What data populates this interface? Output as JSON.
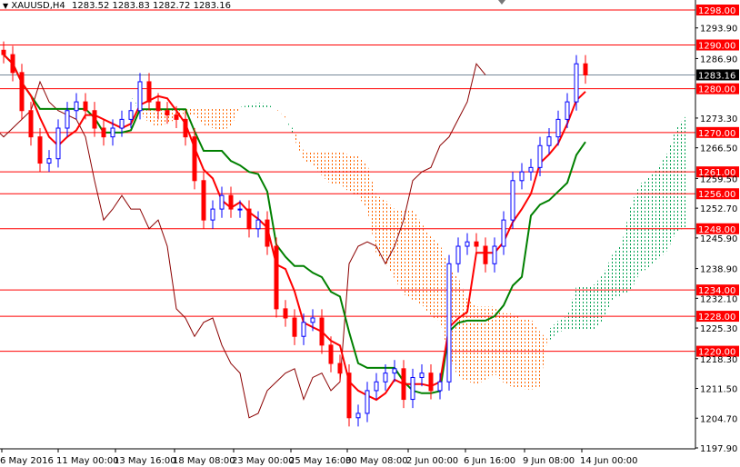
{
  "header": {
    "symbol": "XAUUSD,H4",
    "ohlc": "1283.52 1283.83 1282.72 1283.16"
  },
  "colors": {
    "level": "#ff0000",
    "tenkan": "#ff0000",
    "kijun": "#008000",
    "chikou": "#8b0000",
    "bull": "#0000ff",
    "bear": "#ff0000",
    "cloud_bear": "#ff6600",
    "cloud_bull": "#00a050"
  },
  "chart_data": {
    "type": "candlestick",
    "title": "XAUUSD,H4",
    "ylim": [
      1197.9,
      1298.0
    ],
    "closes": [
      1287.8,
      1283.7,
      1275,
      1269,
      1263,
      1264,
      1271,
      1275,
      1277,
      1275,
      1271,
      1269,
      1271,
      1273,
      1275,
      1281.6,
      1277,
      1275,
      1274,
      1273,
      1269,
      1259,
      1250,
      1252.5,
      1255.6,
      1252.5,
      1252.5,
      1248,
      1250,
      1244,
      1229.7,
      1227.6,
      1223.4,
      1226.6,
      1227.6,
      1221.4,
      1217.2,
      1215,
      1204.8,
      1205.8,
      1211,
      1213,
      1215,
      1216,
      1209,
      1214,
      1215,
      1211,
      1213,
      1240,
      1244,
      1245,
      1244,
      1240,
      1244,
      1250,
      1259,
      1261,
      1262,
      1267,
      1269,
      1273,
      1277,
      1285.7,
      1283.16
    ],
    "current_price": "1283.16",
    "levels": [
      "1298.00",
      "1290.00",
      "1280.00",
      "1270.00",
      "1261.00",
      "1256.00",
      "1248.00",
      "1234.00",
      "1228.00",
      "1220.00"
    ],
    "y_ticks": [
      "1293.90",
      "1286.90",
      "1273.30",
      "1266.50",
      "1259.50",
      "1252.70",
      "1245.90",
      "1238.90",
      "1232.10",
      "1225.30",
      "1218.30",
      "1211.50",
      "1204.70",
      "1197.90"
    ],
    "x_ticks": [
      "6 May 2016",
      "11 May 00:00",
      "13 May 16:00",
      "18 May 08:00",
      "23 May 00:00",
      "25 May 16:00",
      "30 May 08:00",
      "2 Jun 00:00",
      "6 Jun 16:00",
      "9 Jun 08:00",
      "14 Jun 00:00"
    ],
    "indicators": [
      "Ichimoku tenkan",
      "Ichimoku kijun",
      "Ichimoku chikou",
      "Ichimoku cloud"
    ]
  }
}
